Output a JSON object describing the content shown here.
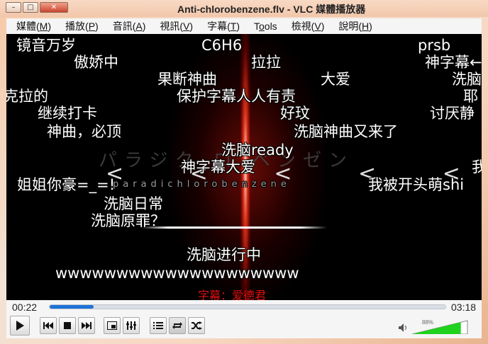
{
  "window": {
    "title": "Anti-chlorobenzene.flv - VLC 媒體播放器"
  },
  "menu": [
    {
      "label": "媒體(",
      "key": "M",
      "end": ")"
    },
    {
      "label": "播放(",
      "key": "P",
      "end": ")"
    },
    {
      "label": "音訊(",
      "key": "A",
      "end": ")"
    },
    {
      "label": "視訊(",
      "key": "V",
      "end": ")"
    },
    {
      "label": "字幕(",
      "key": "T",
      "end": ")"
    },
    {
      "label": "T",
      "key": "o",
      "end": "ols"
    },
    {
      "label": "檢視(",
      "key": "V",
      "end": ")"
    },
    {
      "label": "說明(",
      "key": "H",
      "end": ")"
    }
  ],
  "video": {
    "kana": "パラジク ロ ベンゼン",
    "kana_small": "paradichlorobenzene",
    "kana_big": "< < < < < <",
    "subtitle": "字幕：爱德君",
    "danmaku": [
      "镜音万岁",
      "C6H6",
      "prsb",
      "傲娇中",
      "拉拉",
      "神字幕←",
      "果断神曲",
      "大爱",
      "洗脑",
      "保护字幕人人有责",
      "耶",
      "克拉的",
      "继续打卡",
      "好玟",
      "讨厌静",
      "神曲，必顶",
      "洗脑神曲又来了",
      "洗脑ready",
      "神字幕大爱",
      "我",
      "姐姐你豪=_=!",
      "我被开头萌shi",
      "洗脑日常",
      "洗脑原罪？",
      "洗脑进行中",
      "wwwwwwwwwwwwwwwwwwww"
    ]
  },
  "playback": {
    "elapsed": "00:22",
    "total": "03:18",
    "progress": 0.111
  },
  "volume": {
    "label": "88%",
    "level": 0.88
  },
  "colors": {
    "accent": "#1e73d8",
    "volume": "#1ed21e",
    "subtitle": "#e01010"
  },
  "icons": [
    "play-icon",
    "prev-icon",
    "stop-icon",
    "next-icon",
    "fullscreen-icon",
    "extended-settings-icon",
    "playlist-icon",
    "loop-icon",
    "shuffle-icon",
    "speaker-icon"
  ]
}
